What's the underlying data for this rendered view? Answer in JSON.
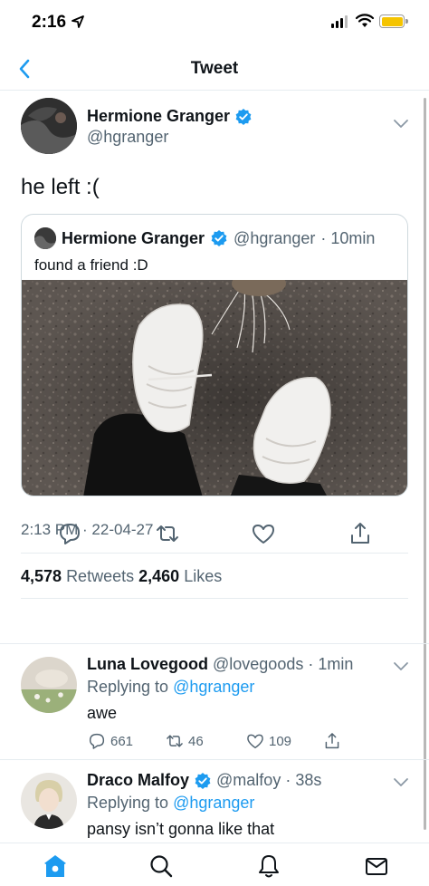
{
  "status": {
    "time": "2:16"
  },
  "nav": {
    "title": "Tweet"
  },
  "tweet": {
    "author_name": "Hermione Granger",
    "author_handle": "@hgranger",
    "text": "he left :(",
    "quote": {
      "author_name": "Hermione Granger",
      "author_handle": "@hgranger",
      "time": "· 10min",
      "text": "found a friend :D"
    },
    "timestamp": "2:13 PM · 22-04-27",
    "retweets_count": "4,578",
    "retweets_label": "Retweets",
    "likes_count": "2,460",
    "likes_label": "Likes"
  },
  "replies": [
    {
      "name": "Luna Lovegood",
      "handle": "@lovegoods",
      "time": "· 1min",
      "replying_prefix": "Replying to",
      "replying_to": "@hgranger",
      "text": "awe",
      "reply_count": "661",
      "retweet_count": "46",
      "like_count": "109"
    },
    {
      "name": "Draco Malfoy",
      "handle": "@malfoy",
      "time": "· 38s",
      "replying_prefix": "Replying to",
      "replying_to": "@hgranger",
      "text": "pansy isn’t gonna like that"
    }
  ],
  "colors": {
    "accent": "#1d9bf0",
    "text": "#0f1419",
    "muted": "#536471",
    "border": "#e6ecf0",
    "battery": "#f5c400"
  },
  "icons": [
    "location-arrow-icon",
    "signal-icon",
    "wifi-icon",
    "battery-icon",
    "back-chevron-icon",
    "verified-badge-icon",
    "chevron-down-icon",
    "reply-icon",
    "retweet-icon",
    "like-icon",
    "share-icon",
    "home-icon",
    "search-icon",
    "notifications-icon",
    "messages-icon"
  ]
}
